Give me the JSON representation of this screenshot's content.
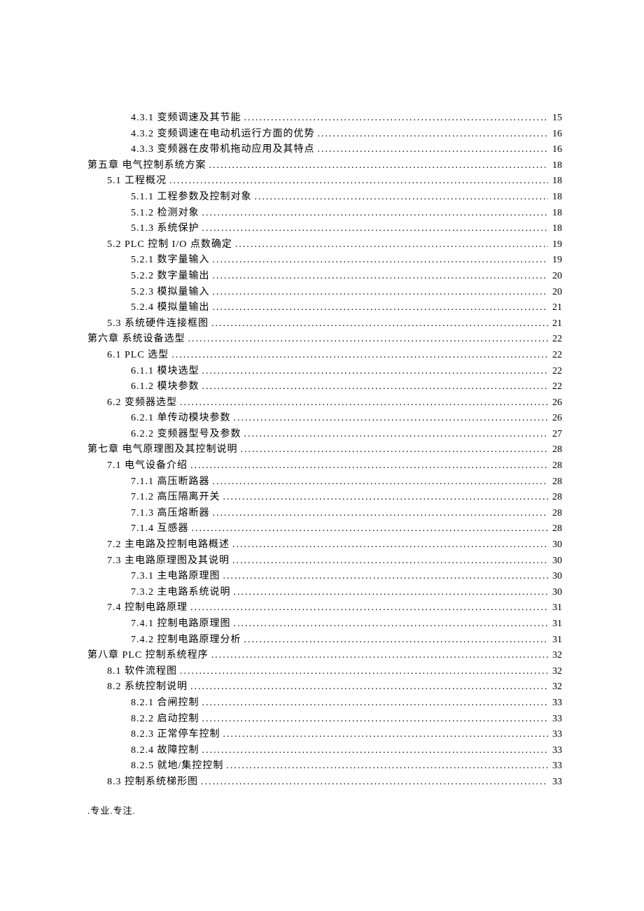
{
  "toc": [
    {
      "level": 3,
      "num": "4.3.1",
      "title": "变频调速及其节能",
      "page": "15"
    },
    {
      "level": 3,
      "num": "4.3.2",
      "title": "变频调速在电动机运行方面的优势",
      "page": "16"
    },
    {
      "level": 3,
      "num": "4.3.3",
      "title": "变频器在皮带机拖动应用及其特点",
      "page": "16"
    },
    {
      "level": 1,
      "num": "第五章",
      "title": "电气控制系统方案",
      "page": "18"
    },
    {
      "level": 2,
      "num": "5.1",
      "title": "工程概况",
      "page": "18"
    },
    {
      "level": 3,
      "num": "5.1.1",
      "title": "工程参数及控制对象",
      "page": "18"
    },
    {
      "level": 3,
      "num": "5.1.2",
      "title": "检测对象",
      "page": "18"
    },
    {
      "level": 3,
      "num": "5.1.3",
      "title": "系统保护",
      "page": "18"
    },
    {
      "level": 2,
      "num": "5.2",
      "title": "PLC 控制 I/O 点数确定",
      "page": "19"
    },
    {
      "level": 3,
      "num": "5.2.1",
      "title": "数字量输入",
      "page": "19"
    },
    {
      "level": 3,
      "num": "5.2.2",
      "title": "数字量输出",
      "page": "20"
    },
    {
      "level": 3,
      "num": "5.2.3",
      "title": "模拟量输入",
      "page": "20"
    },
    {
      "level": 3,
      "num": "5.2.4",
      "title": "模拟量输出",
      "page": "21"
    },
    {
      "level": 2,
      "num": "5.3",
      "title": "系统硬件连接框图",
      "page": "21"
    },
    {
      "level": 1,
      "num": "第六章",
      "title": "系统设备选型",
      "page": "22"
    },
    {
      "level": 2,
      "num": "6.1",
      "title": "PLC 选型",
      "page": "22"
    },
    {
      "level": 3,
      "num": "6.1.1",
      "title": "模块选型",
      "page": "22"
    },
    {
      "level": 3,
      "num": "6.1.2",
      "title": "模块参数",
      "page": "22"
    },
    {
      "level": 2,
      "num": "6.2",
      "title": "变频器选型",
      "page": "26"
    },
    {
      "level": 3,
      "num": "6.2.1",
      "title": "单传动模块参数",
      "page": "26"
    },
    {
      "level": 3,
      "num": "6.2.2",
      "title": "变频器型号及参数",
      "page": "27"
    },
    {
      "level": 1,
      "num": "第七章",
      "title": "电气原理图及其控制说明",
      "page": "28"
    },
    {
      "level": 2,
      "num": "7.1",
      "title": "电气设备介绍",
      "page": "28"
    },
    {
      "level": 3,
      "num": "7.1.1",
      "title": "高压断路器",
      "page": "28"
    },
    {
      "level": 3,
      "num": "7.1.2",
      "title": "高压隔离开关",
      "page": "28"
    },
    {
      "level": 3,
      "num": "7.1.3",
      "title": "高压熔断器",
      "page": "28"
    },
    {
      "level": 3,
      "num": "7.1.4",
      "title": "互感器",
      "page": "28"
    },
    {
      "level": 2,
      "num": "7.2",
      "title": "主电路及控制电路概述",
      "page": "30"
    },
    {
      "level": 2,
      "num": "7.3",
      "title": "主电路原理图及其说明",
      "page": "30"
    },
    {
      "level": 3,
      "num": "7.3.1",
      "title": "主电路原理图",
      "page": "30"
    },
    {
      "level": 3,
      "num": "7.3.2",
      "title": "主电路系统说明",
      "page": "30"
    },
    {
      "level": 2,
      "num": "7.4",
      "title": "控制电路原理",
      "page": "31"
    },
    {
      "level": 3,
      "num": "7.4.1",
      "title": "控制电路原理图",
      "page": "31"
    },
    {
      "level": 3,
      "num": "7.4.2",
      "title": "控制电路原理分析",
      "page": "31"
    },
    {
      "level": 1,
      "num": "第八章",
      "title": "PLC 控制系统程序",
      "page": "32"
    },
    {
      "level": 2,
      "num": "8.1",
      "title": "软件流程图",
      "page": "32"
    },
    {
      "level": 2,
      "num": "8.2",
      "title": "系统控制说明",
      "page": "32"
    },
    {
      "level": 3,
      "num": "8.2.1",
      "title": "合闸控制",
      "page": "33"
    },
    {
      "level": 3,
      "num": "8.2.2",
      "title": "启动控制",
      "page": "33"
    },
    {
      "level": 3,
      "num": "8.2.3",
      "title": "正常停车控制",
      "page": "33"
    },
    {
      "level": 3,
      "num": "8.2.4",
      "title": "故障控制",
      "page": "33"
    },
    {
      "level": 3,
      "num": "8.2.5",
      "title": "就地/集控控制",
      "page": "33"
    },
    {
      "level": 2,
      "num": "8.3",
      "title": "控制系统梯形图",
      "page": "33"
    }
  ],
  "footer": ".专业.专注."
}
